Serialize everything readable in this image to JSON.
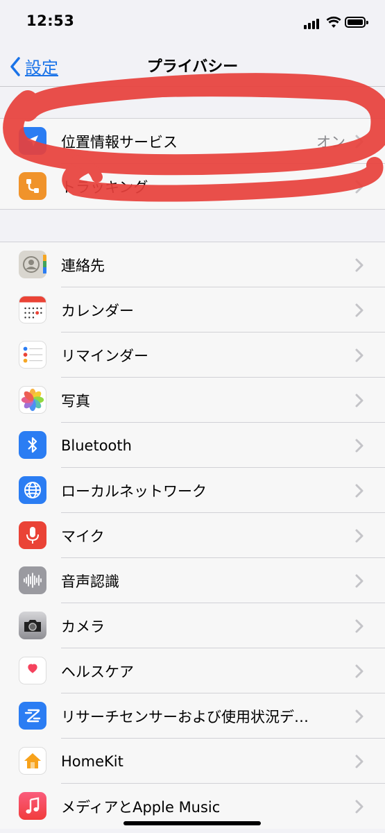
{
  "status_bar": {
    "time": "12:53"
  },
  "nav": {
    "back_label": "設定",
    "title": "プライバシー"
  },
  "group1": [
    {
      "label": "位置情報サービス",
      "value": "オン",
      "icon": "location-arrow-icon",
      "color": "#2b7df3"
    },
    {
      "label": "トラッキング",
      "value": "",
      "icon": "tracking-icon",
      "color": "#f0932b"
    }
  ],
  "group2": [
    {
      "label": "連絡先",
      "icon": "contacts-icon"
    },
    {
      "label": "カレンダー",
      "icon": "calendar-icon"
    },
    {
      "label": "リマインダー",
      "icon": "reminders-icon"
    },
    {
      "label": "写真",
      "icon": "photos-icon"
    },
    {
      "label": "Bluetooth",
      "icon": "bluetooth-icon",
      "color": "#2b7df3"
    },
    {
      "label": "ローカルネットワーク",
      "icon": "globe-icon",
      "color": "#2b7df3"
    },
    {
      "label": "マイク",
      "icon": "microphone-icon",
      "color": "#ea4336"
    },
    {
      "label": "音声認識",
      "icon": "waveform-icon",
      "color": "#9a9aa0"
    },
    {
      "label": "カメラ",
      "icon": "camera-icon",
      "color": "#8e8e93"
    },
    {
      "label": "ヘルスケア",
      "icon": "heart-icon"
    },
    {
      "label": "リサーチセンサーおよび使用状況デ…",
      "icon": "research-icon",
      "color": "#2b7df3"
    },
    {
      "label": "HomeKit",
      "icon": "home-icon"
    },
    {
      "label": "メディアとApple Music",
      "icon": "music-icon",
      "color": "#f5425d"
    }
  ],
  "annotation_color": "#e8413c"
}
